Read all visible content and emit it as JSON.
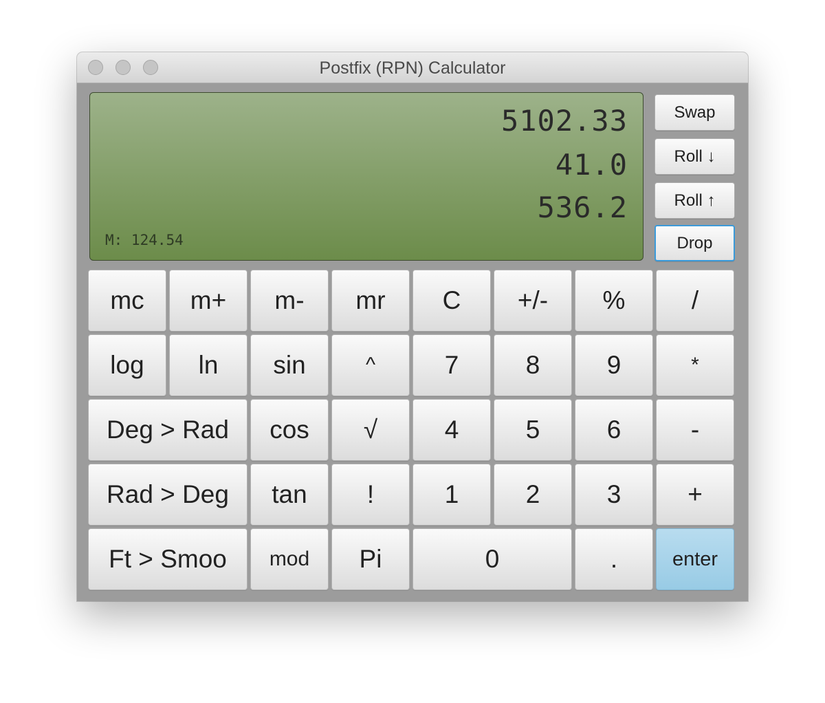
{
  "window": {
    "title": "Postfix (RPN) Calculator"
  },
  "display": {
    "stack": [
      "5102.33",
      "41.0",
      "536.2"
    ],
    "memory": "M: 124.54"
  },
  "stack_controls": {
    "swap": "Swap",
    "roll_down": "Roll ↓",
    "roll_up": "Roll ↑",
    "drop": "Drop"
  },
  "keypad": {
    "row1": [
      "mc",
      "m+",
      "m-",
      "mr",
      "C",
      "+/-",
      "%",
      "/"
    ],
    "row2": [
      "log",
      "ln",
      "sin",
      "^",
      "7",
      "8",
      "9",
      "*"
    ],
    "row3": [
      "Deg > Rad",
      "cos",
      "√",
      "4",
      "5",
      "6",
      "-"
    ],
    "row4": [
      "Rad > Deg",
      "tan",
      "!",
      "1",
      "2",
      "3",
      "+"
    ],
    "row5": [
      "Ft > Smoo",
      "mod",
      "Pi",
      "0",
      ".",
      "enter"
    ]
  },
  "colors": {
    "lcd_top": "#9db28a",
    "lcd_bottom": "#6c8c4a",
    "enter_key": "#a8d3ea",
    "focus_ring": "#3a9ad9"
  }
}
